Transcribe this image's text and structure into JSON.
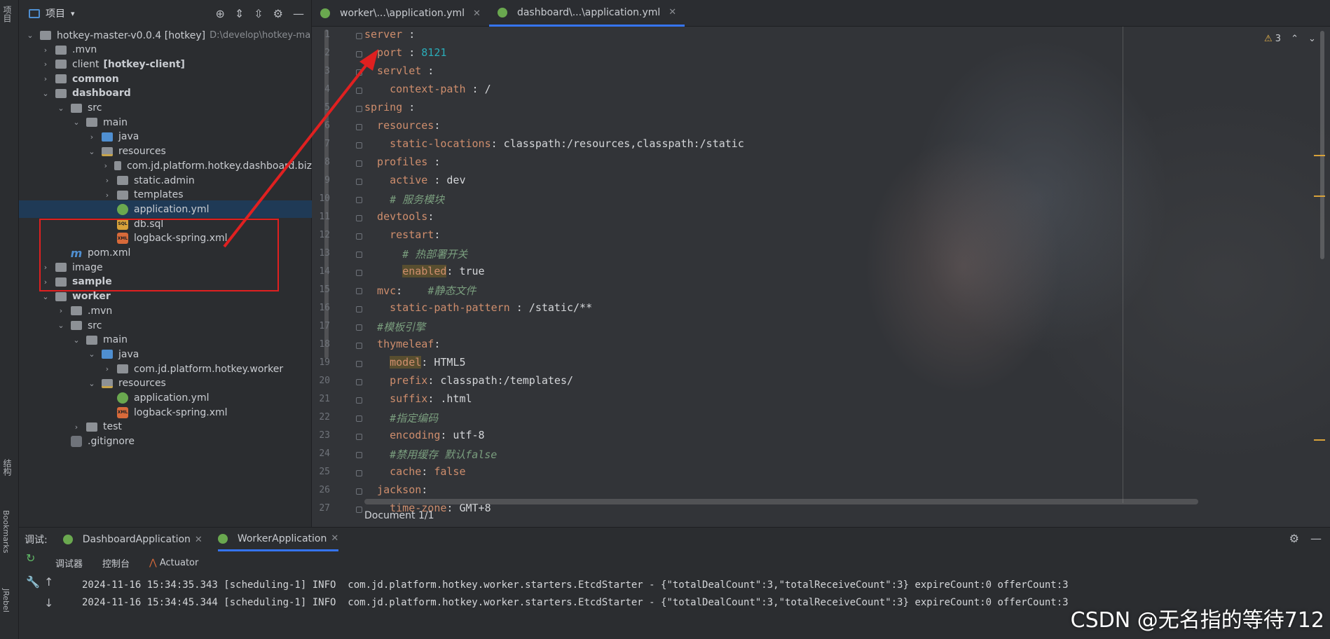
{
  "left_strip": {
    "project_label": "项目",
    "structure_label": "结构",
    "bookmarks_label": "Bookmarks",
    "jrebel_label": "JRebel"
  },
  "project_panel": {
    "title": "项目",
    "tools": [
      "locate-icon",
      "expand-all-icon",
      "collapse-all-icon",
      "gear-icon",
      "minimize-icon"
    ],
    "tree": [
      {
        "label": "hotkey-master-v0.0.4 [hotkey]",
        "extra": "D:\\develop\\hotkey-ma",
        "depth": 0,
        "kind": "folder",
        "open": true
      },
      {
        "label": ".mvn",
        "depth": 1,
        "kind": "folder"
      },
      {
        "label": "client",
        "extra": "[hotkey-client]",
        "depth": 1,
        "kind": "folder"
      },
      {
        "label": "common",
        "depth": 1,
        "kind": "folder",
        "bold": true
      },
      {
        "label": "dashboard",
        "depth": 1,
        "kind": "folder",
        "bold": true,
        "open": true
      },
      {
        "label": "src",
        "depth": 2,
        "kind": "folder",
        "open": true
      },
      {
        "label": "main",
        "depth": 3,
        "kind": "folder",
        "open": true
      },
      {
        "label": "java",
        "depth": 4,
        "kind": "folder-blue"
      },
      {
        "label": "resources",
        "depth": 4,
        "kind": "folder-res",
        "open": true
      },
      {
        "label": "com.jd.platform.hotkey.dashboard.biz",
        "depth": 5,
        "kind": "folder"
      },
      {
        "label": "static.admin",
        "depth": 5,
        "kind": "folder"
      },
      {
        "label": "templates",
        "depth": 5,
        "kind": "folder"
      },
      {
        "label": "application.yml",
        "depth": 5,
        "kind": "yml",
        "selected": true
      },
      {
        "label": "db.sql",
        "depth": 5,
        "kind": "sql"
      },
      {
        "label": "logback-spring.xml",
        "depth": 5,
        "kind": "xml"
      },
      {
        "label": "pom.xml",
        "depth": 2,
        "kind": "mvn"
      },
      {
        "label": "image",
        "depth": 1,
        "kind": "folder"
      },
      {
        "label": "sample",
        "depth": 1,
        "kind": "folder",
        "bold": true
      },
      {
        "label": "worker",
        "depth": 1,
        "kind": "folder",
        "bold": true,
        "open": true
      },
      {
        "label": ".mvn",
        "depth": 2,
        "kind": "folder"
      },
      {
        "label": "src",
        "depth": 2,
        "kind": "folder",
        "open": true
      },
      {
        "label": "main",
        "depth": 3,
        "kind": "folder",
        "open": true
      },
      {
        "label": "java",
        "depth": 4,
        "kind": "folder-blue",
        "open": true
      },
      {
        "label": "com.jd.platform.hotkey.worker",
        "depth": 5,
        "kind": "folder"
      },
      {
        "label": "resources",
        "depth": 4,
        "kind": "folder-res",
        "open": true
      },
      {
        "label": "application.yml",
        "depth": 5,
        "kind": "yml"
      },
      {
        "label": "logback-spring.xml",
        "depth": 5,
        "kind": "xml"
      },
      {
        "label": "test",
        "depth": 3,
        "kind": "folder"
      },
      {
        "label": ".gitignore",
        "depth": 2,
        "kind": "file"
      }
    ]
  },
  "editor": {
    "tabs": [
      {
        "label": "worker\\...\\application.yml",
        "active": false
      },
      {
        "label": "dashboard\\...\\application.yml",
        "active": true
      }
    ],
    "warnings_count": "3",
    "status": "Document 1/1",
    "lines": [
      {
        "n": "1",
        "parts": [
          [
            "key",
            "server"
          ],
          [
            "val",
            " :"
          ]
        ]
      },
      {
        "n": "2",
        "parts": [
          [
            "key",
            "  port"
          ],
          [
            "val",
            " : "
          ],
          [
            "num",
            "8121"
          ]
        ]
      },
      {
        "n": "3",
        "parts": [
          [
            "key",
            "  servlet"
          ],
          [
            "val",
            " :"
          ]
        ]
      },
      {
        "n": "4",
        "parts": [
          [
            "key",
            "    context-path"
          ],
          [
            "val",
            " : /"
          ]
        ]
      },
      {
        "n": "5",
        "parts": [
          [
            "key",
            "spring"
          ],
          [
            "val",
            " :"
          ]
        ]
      },
      {
        "n": "6",
        "parts": [
          [
            "key",
            "  resources"
          ],
          [
            "val",
            ":"
          ]
        ]
      },
      {
        "n": "7",
        "parts": [
          [
            "key",
            "    static-locations"
          ],
          [
            "val",
            ": classpath:/resources,classpath:/static"
          ]
        ]
      },
      {
        "n": "8",
        "parts": [
          [
            "key",
            "  profiles"
          ],
          [
            "val",
            " :"
          ]
        ]
      },
      {
        "n": "9",
        "parts": [
          [
            "key",
            "    active"
          ],
          [
            "val",
            " : dev"
          ]
        ]
      },
      {
        "n": "10",
        "parts": [
          [
            "cmt",
            "    # 服务模块"
          ]
        ]
      },
      {
        "n": "11",
        "parts": [
          [
            "key",
            "  devtools"
          ],
          [
            "val",
            ":"
          ]
        ]
      },
      {
        "n": "12",
        "parts": [
          [
            "key",
            "    restart"
          ],
          [
            "val",
            ":"
          ]
        ]
      },
      {
        "n": "13",
        "parts": [
          [
            "cmt",
            "      # 热部署开关"
          ]
        ]
      },
      {
        "n": "14",
        "parts": [
          [
            "val",
            "      "
          ],
          [
            "key hl",
            "enabled"
          ],
          [
            "val",
            ": true"
          ]
        ]
      },
      {
        "n": "15",
        "parts": [
          [
            "key",
            "  mvc"
          ],
          [
            "val",
            ":    "
          ],
          [
            "cmt",
            "#静态文件"
          ]
        ]
      },
      {
        "n": "16",
        "parts": [
          [
            "key",
            "    static-path-pattern"
          ],
          [
            "val",
            " : /static/**"
          ]
        ]
      },
      {
        "n": "17",
        "parts": [
          [
            "cmt",
            "  #模板引擎"
          ]
        ]
      },
      {
        "n": "18",
        "parts": [
          [
            "key",
            "  thymeleaf"
          ],
          [
            "val",
            ":"
          ]
        ]
      },
      {
        "n": "19",
        "parts": [
          [
            "val",
            "    "
          ],
          [
            "key hl",
            "model"
          ],
          [
            "val",
            ": HTML5"
          ]
        ]
      },
      {
        "n": "20",
        "parts": [
          [
            "key",
            "    prefix"
          ],
          [
            "val",
            ": classpath:/templates/"
          ]
        ]
      },
      {
        "n": "21",
        "parts": [
          [
            "key",
            "    suffix"
          ],
          [
            "val",
            ": .html"
          ]
        ]
      },
      {
        "n": "22",
        "parts": [
          [
            "cmt",
            "    #指定编码"
          ]
        ]
      },
      {
        "n": "23",
        "parts": [
          [
            "key",
            "    encoding"
          ],
          [
            "val",
            ": utf-8"
          ]
        ]
      },
      {
        "n": "24",
        "parts": [
          [
            "cmt",
            "    #禁用缓存 默认false"
          ]
        ]
      },
      {
        "n": "25",
        "parts": [
          [
            "key",
            "    cache"
          ],
          [
            "val",
            ": "
          ],
          [
            "key",
            "false"
          ]
        ]
      },
      {
        "n": "26",
        "parts": [
          [
            "key",
            "  jackson"
          ],
          [
            "val",
            ":"
          ]
        ]
      },
      {
        "n": "27",
        "parts": [
          [
            "key",
            "    time-zone"
          ],
          [
            "val",
            ": GMT+8"
          ]
        ]
      }
    ]
  },
  "bottom": {
    "debug_label": "调试:",
    "run_tabs": [
      {
        "label": "DashboardApplication",
        "active": false
      },
      {
        "label": "WorkerApplication",
        "active": true
      }
    ],
    "sub_tabs": [
      "调试器",
      "控制台",
      "Actuator"
    ],
    "log": [
      "2024-11-16 15:34:35.343 [scheduling-1] INFO  com.jd.platform.hotkey.worker.starters.EtcdStarter - {\"totalDealCount\":3,\"totalReceiveCount\":3} expireCount:0 offerCount:3",
      "2024-11-16 15:34:45.344 [scheduling-1] INFO  com.jd.platform.hotkey.worker.starters.EtcdStarter - {\"totalDealCount\":3,\"totalReceiveCount\":3} expireCount:0 offerCount:3"
    ],
    "watermark": "CSDN @无名指的等待712"
  },
  "colors": {
    "accent": "#3574f0",
    "annotation": "#e02020",
    "selection": "#1f3a56"
  }
}
